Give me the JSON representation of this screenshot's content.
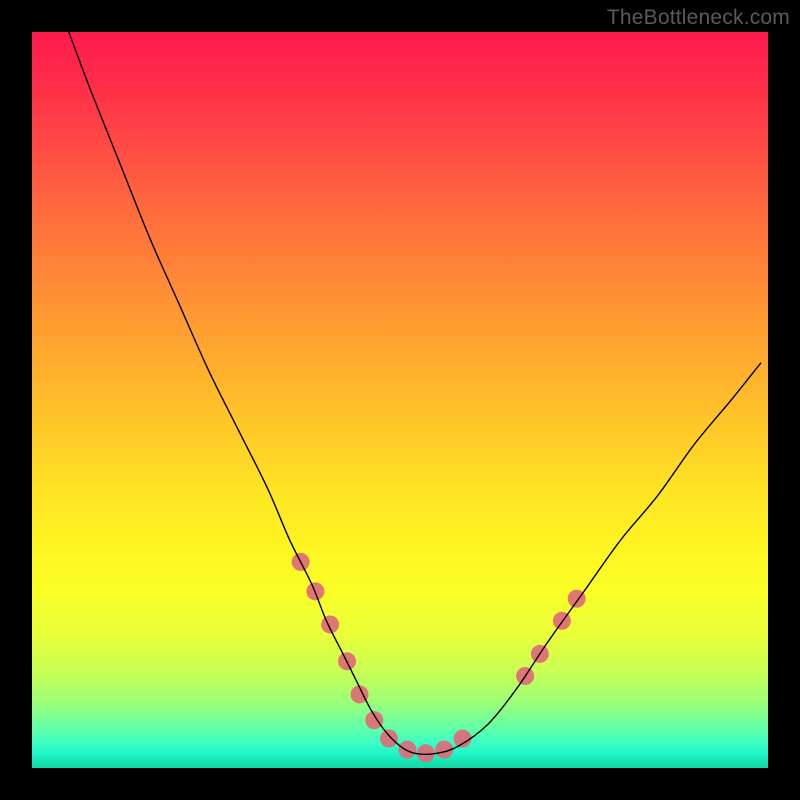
{
  "watermark": "TheBottleneck.com",
  "chart_data": {
    "type": "line",
    "title": "",
    "xlabel": "",
    "ylabel": "",
    "xlim": [
      0,
      100
    ],
    "ylim": [
      0,
      100
    ],
    "grid": false,
    "series": [
      {
        "name": "curve",
        "color": "#000000",
        "stroke_width": 1.4,
        "x": [
          5,
          8,
          12,
          16,
          20,
          24,
          28,
          32,
          35,
          38,
          40,
          42,
          44,
          46,
          48,
          50,
          52,
          55,
          58,
          62,
          66,
          70,
          75,
          80,
          85,
          90,
          95,
          99
        ],
        "values": [
          100,
          92,
          82,
          72,
          63,
          54,
          46,
          38,
          31,
          25,
          20,
          16,
          12,
          8,
          5,
          3,
          2,
          2,
          3,
          6,
          11,
          17,
          24,
          31,
          37,
          44,
          50,
          55
        ]
      }
    ],
    "markers": {
      "name": "highlight-points",
      "color": "#e06a7a",
      "radius": 9,
      "points": [
        {
          "x": 36.5,
          "y": 28
        },
        {
          "x": 38.5,
          "y": 24
        },
        {
          "x": 40.5,
          "y": 19.5
        },
        {
          "x": 42.8,
          "y": 14.5
        },
        {
          "x": 44.5,
          "y": 10
        },
        {
          "x": 46.5,
          "y": 6.5
        },
        {
          "x": 48.5,
          "y": 4
        },
        {
          "x": 51,
          "y": 2.5
        },
        {
          "x": 53.5,
          "y": 2
        },
        {
          "x": 56,
          "y": 2.5
        },
        {
          "x": 58.5,
          "y": 4
        },
        {
          "x": 67,
          "y": 12.5
        },
        {
          "x": 69,
          "y": 15.5
        },
        {
          "x": 72,
          "y": 20
        },
        {
          "x": 74,
          "y": 23
        }
      ]
    }
  }
}
